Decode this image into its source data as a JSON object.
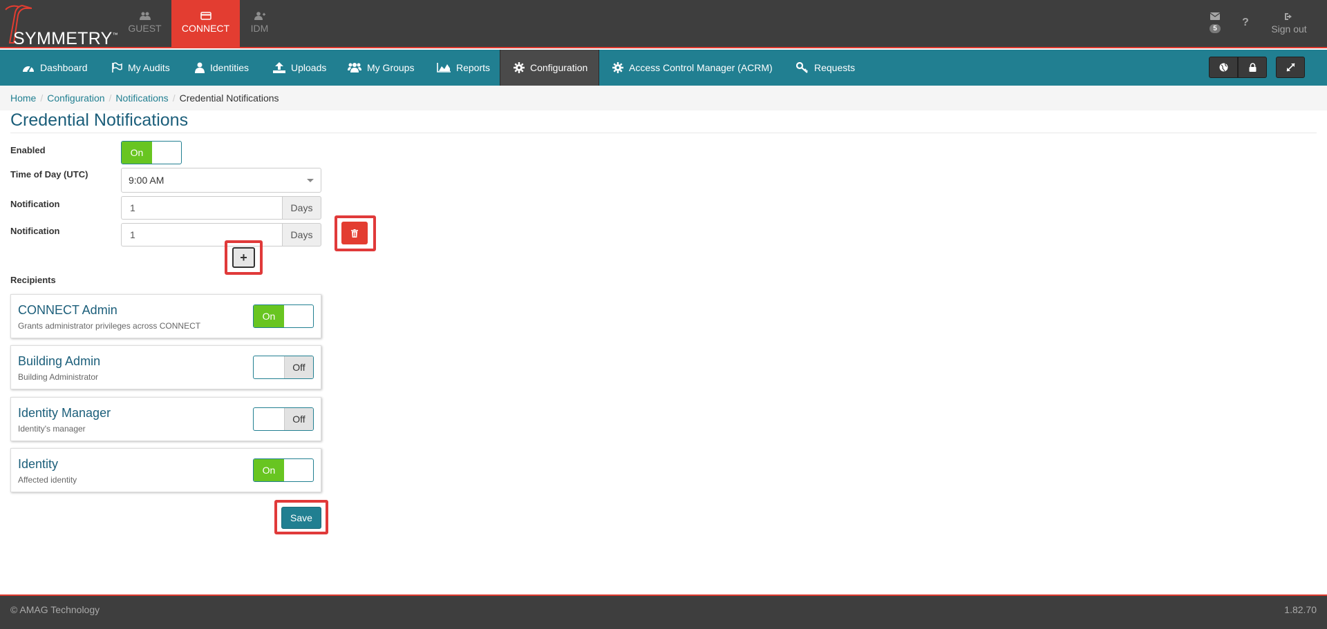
{
  "brand": {
    "logo_text": "SYMMETRY",
    "trademark": "™"
  },
  "app_tabs": [
    {
      "label": "GUEST",
      "icon": "users-icon"
    },
    {
      "label": "CONNECT",
      "icon": "card-icon",
      "active": true
    },
    {
      "label": "IDM",
      "icon": "user-plus-icon"
    }
  ],
  "topbar_right": {
    "messages_count": "5",
    "help_label": "?",
    "signout_label": "Sign out"
  },
  "nav": {
    "items": [
      {
        "label": "Dashboard",
        "icon": "dashboard-icon"
      },
      {
        "label": "My Audits",
        "icon": "flag-icon"
      },
      {
        "label": "Identities",
        "icon": "user-icon"
      },
      {
        "label": "Uploads",
        "icon": "upload-icon"
      },
      {
        "label": "My Groups",
        "icon": "group-icon"
      },
      {
        "label": "Reports",
        "icon": "chart-icon"
      },
      {
        "label": "Configuration",
        "icon": "gear-icon",
        "active": true
      },
      {
        "label": "Access Control Manager (ACRM)",
        "icon": "gear-icon"
      },
      {
        "label": "Requests",
        "icon": "key-icon"
      }
    ],
    "right_buttons": [
      "globe-icon",
      "lock-icon",
      "expand-icon"
    ]
  },
  "breadcrumb": [
    "Home",
    "Configuration",
    "Notifications",
    "Credential Notifications"
  ],
  "page_title": "Credential Notifications",
  "form": {
    "enabled_label": "Enabled",
    "enabled_value": "On",
    "time_label": "Time of Day (UTC)",
    "time_value": "9:00 AM",
    "notifications": [
      {
        "label": "Notification",
        "value": "1",
        "unit": "Days"
      },
      {
        "label": "Notification",
        "value": "1",
        "unit": "Days"
      }
    ],
    "add_button": "+",
    "recipients_label": "Recipients",
    "recipients": [
      {
        "title": "CONNECT Admin",
        "desc": "Grants administrator privileges across CONNECT",
        "state": "On"
      },
      {
        "title": "Building Admin",
        "desc": "Building Administrator",
        "state": "Off"
      },
      {
        "title": "Identity Manager",
        "desc": "Identity's manager",
        "state": "Off"
      },
      {
        "title": "Identity",
        "desc": "Affected identity",
        "state": "On"
      }
    ],
    "save_label": "Save"
  },
  "footer": {
    "copyright": "© AMAG Technology",
    "version": "1.82.70"
  },
  "colors": {
    "accent": "#217f91",
    "brand_red": "#e33d31",
    "toggle_on": "#68c521",
    "topbar": "#3e3e3e"
  }
}
